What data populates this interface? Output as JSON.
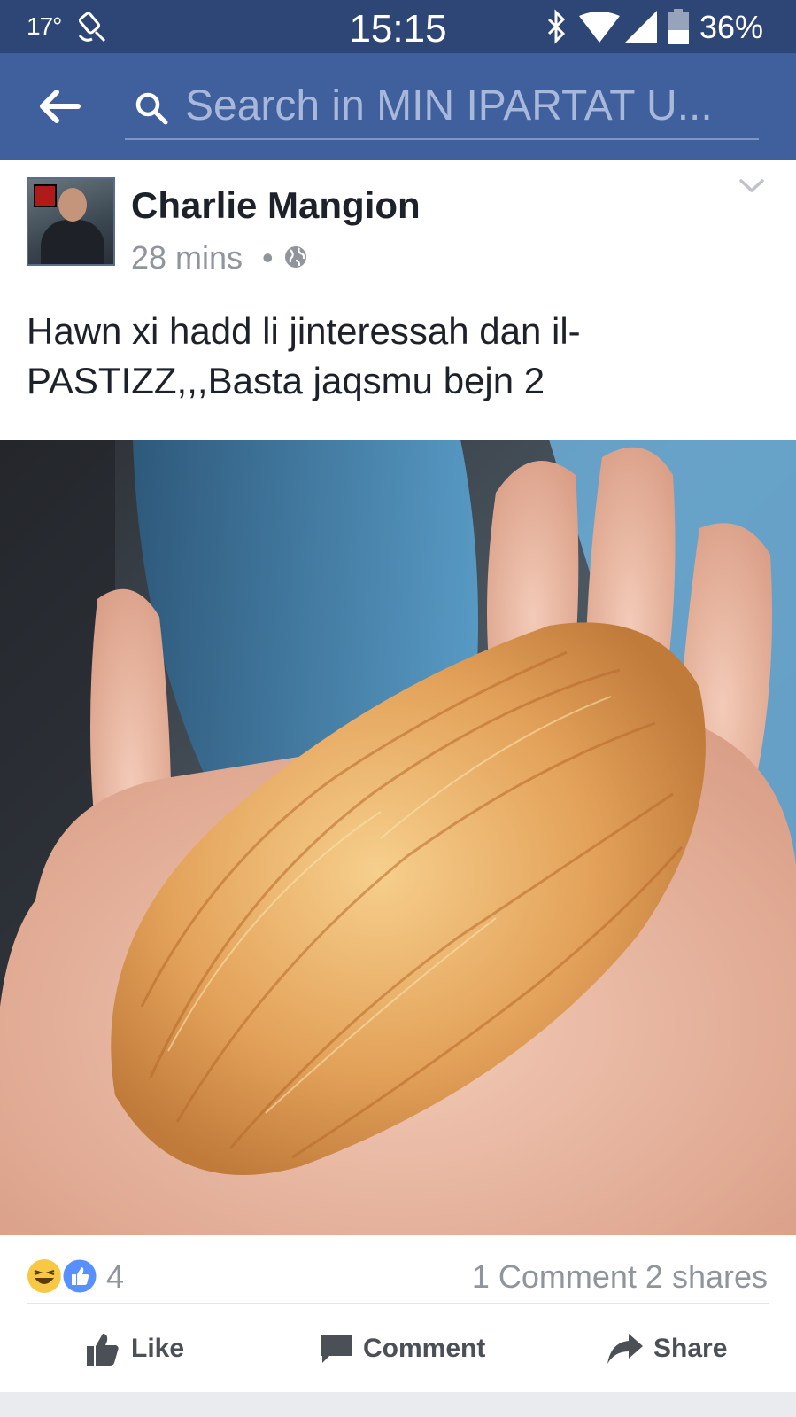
{
  "status_bar": {
    "temperature": "17°",
    "time": "15:15",
    "battery": "36%"
  },
  "header": {
    "search_placeholder": "Search in MIN IPARTAT U..."
  },
  "post": {
    "author": "Charlie Mangion",
    "time": "28 mins",
    "separator": "•",
    "text_line1": "Hawn xi hadd li jinteressah dan il-",
    "text_line2": "PASTIZZ,,,Basta jaqsmu bejn 2",
    "reaction_count": "4",
    "comments": "1 Comment",
    "shares": "2 shares"
  },
  "actions": {
    "like_label": "Like",
    "comment_label": "Comment",
    "share_label": "Share"
  },
  "colors": {
    "status_bar": "#2e4676",
    "header": "#3f5f9d",
    "meta_text": "#90949c",
    "like_blue": "#4267b2"
  }
}
